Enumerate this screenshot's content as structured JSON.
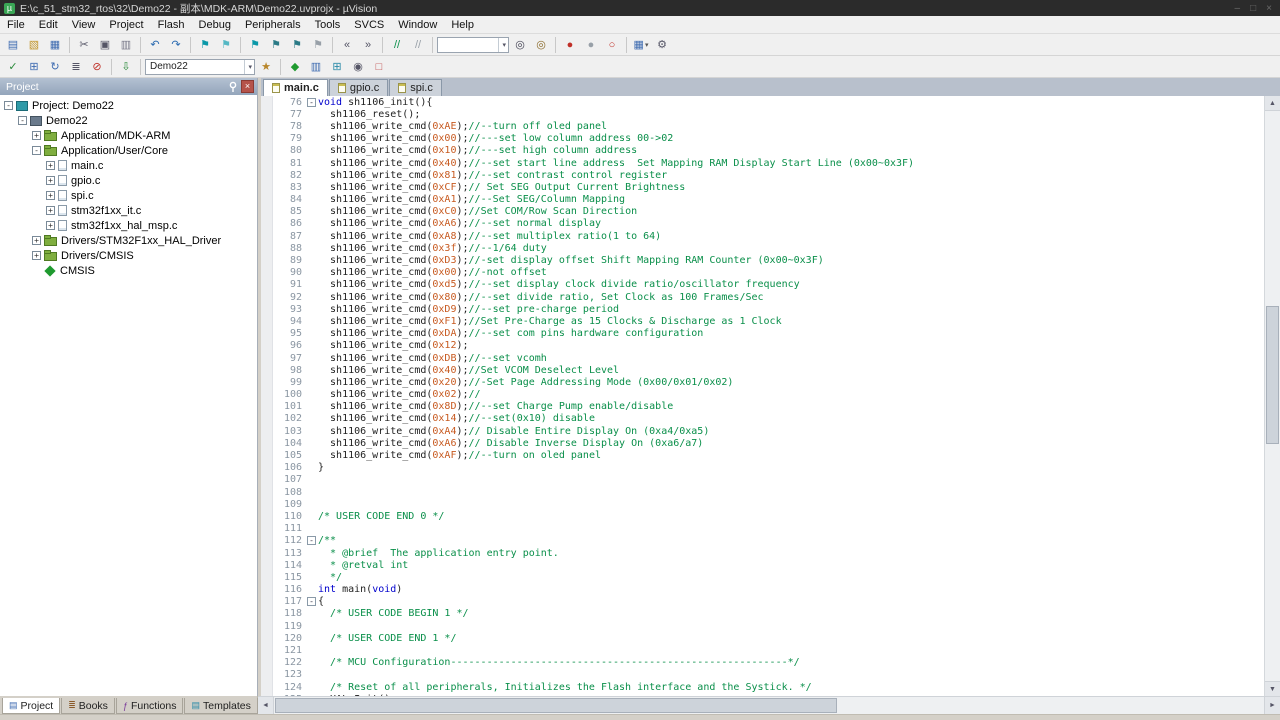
{
  "colors": {
    "keyword": "#0000cc",
    "comment": "#0a8f4a",
    "number": "#c75a20",
    "accent_green": "#3aa655"
  },
  "window": {
    "title": "E:\\c_51_stm32_rtos\\32\\Demo22 - 副本\\MDK-ARM\\Demo22.uvprojx - µVision",
    "controls": {
      "minimize": "–",
      "maximize": "□",
      "close": "×"
    }
  },
  "menubar": {
    "items": [
      "File",
      "Edit",
      "View",
      "Project",
      "Flash",
      "Debug",
      "Peripherals",
      "Tools",
      "SVCS",
      "Window",
      "Help"
    ]
  },
  "toolbars": {
    "main": [
      {
        "icon": "new-file-icon"
      },
      {
        "icon": "open-file-icon"
      },
      {
        "icon": "save-file-icon"
      },
      {
        "sep": true
      },
      {
        "icon": "cut-icon"
      },
      {
        "icon": "copy-icon"
      },
      {
        "icon": "paste-icon"
      },
      {
        "sep": true
      },
      {
        "icon": "undo-icon"
      },
      {
        "icon": "redo-icon"
      },
      {
        "sep": true
      },
      {
        "icon": "navigate-back-icon"
      },
      {
        "icon": "navigate-forward-icon"
      },
      {
        "sep": true
      },
      {
        "icon": "toggle-bookmark-icon"
      },
      {
        "icon": "prev-bookmark-icon"
      },
      {
        "icon": "next-bookmark-icon"
      },
      {
        "icon": "clear-bookmarks-icon"
      },
      {
        "sep": true
      },
      {
        "icon": "indent-left-icon"
      },
      {
        "icon": "indent-right-icon"
      },
      {
        "sep": true
      },
      {
        "icon": "comment-icon"
      },
      {
        "icon": "uncomment-icon"
      },
      {
        "sep": true
      },
      {
        "combo": "find-combo",
        "value": "",
        "width": 72
      },
      {
        "icon": "find-icon"
      },
      {
        "icon": "find-in-files-icon"
      },
      {
        "sep": true
      },
      {
        "icon": "toggle-breakpoint-icon"
      },
      {
        "icon": "disable-breakpoints-icon"
      },
      {
        "icon": "kill-breakpoints-icon"
      },
      {
        "sep": true
      },
      {
        "icon": "window-layout-icon",
        "dropdown": true
      },
      {
        "icon": "configure-icon"
      }
    ],
    "build": [
      {
        "icon": "translate-icon"
      },
      {
        "icon": "build-icon"
      },
      {
        "icon": "rebuild-icon"
      },
      {
        "icon": "batch-build-icon"
      },
      {
        "icon": "stop-build-icon"
      },
      {
        "sep": true
      },
      {
        "icon": "download-icon"
      },
      {
        "sep": true
      },
      {
        "combo": "target-select",
        "value": "Demo22",
        "width": 110
      },
      {
        "icon": "target-options-icon"
      },
      {
        "sep": true
      },
      {
        "icon": "manage-rte-icon"
      },
      {
        "icon": "file-extensions-icon"
      },
      {
        "icon": "pack-installer-icon"
      },
      {
        "icon": "debug-session-icon"
      },
      {
        "icon": "flash-erase-icon"
      }
    ]
  },
  "project_panel": {
    "title": "Project",
    "tree": [
      {
        "label": "Project: Demo22",
        "level": 0,
        "icon": "workspace",
        "exp": "minus"
      },
      {
        "label": "Demo22",
        "level": 1,
        "icon": "target",
        "exp": "minus"
      },
      {
        "label": "Application/MDK-ARM",
        "level": 2,
        "icon": "folder",
        "exp": "plus"
      },
      {
        "label": "Application/User/Core",
        "level": 2,
        "icon": "folder",
        "exp": "minus"
      },
      {
        "label": "main.c",
        "level": 3,
        "icon": "file",
        "exp": "plus"
      },
      {
        "label": "gpio.c",
        "level": 3,
        "icon": "file",
        "exp": "plus"
      },
      {
        "label": "spi.c",
        "level": 3,
        "icon": "file",
        "exp": "plus"
      },
      {
        "label": "stm32f1xx_it.c",
        "level": 3,
        "icon": "file",
        "exp": "plus"
      },
      {
        "label": "stm32f1xx_hal_msp.c",
        "level": 3,
        "icon": "file",
        "exp": "plus"
      },
      {
        "label": "Drivers/STM32F1xx_HAL_Driver",
        "level": 2,
        "icon": "folder",
        "exp": "plus"
      },
      {
        "label": "Drivers/CMSIS",
        "level": 2,
        "icon": "folder",
        "exp": "plus"
      },
      {
        "label": "CMSIS",
        "level": 2,
        "icon": "cmsis",
        "exp": "none"
      }
    ]
  },
  "editor": {
    "tabs": [
      {
        "label": "main.c",
        "active": true
      },
      {
        "label": "gpio.c",
        "active": false
      },
      {
        "label": "spi.c",
        "active": false
      }
    ],
    "lines": [
      {
        "n": 76,
        "f": 1,
        "s": [
          [
            "k",
            "void"
          ],
          [
            "p",
            " sh1106_init(){"
          ]
        ]
      },
      {
        "n": 77,
        "s": [
          [
            "p",
            "  sh1106_reset();"
          ]
        ]
      },
      {
        "n": 78,
        "s": [
          [
            "p",
            "  sh1106_write_cmd("
          ],
          [
            "n",
            "0xAE"
          ],
          [
            "p",
            ");"
          ],
          [
            "c",
            "//--turn off oled panel"
          ]
        ]
      },
      {
        "n": 79,
        "s": [
          [
            "p",
            "  sh1106_write_cmd("
          ],
          [
            "n",
            "0x00"
          ],
          [
            "p",
            ");"
          ],
          [
            "c",
            "//---set low column address 00->02"
          ]
        ]
      },
      {
        "n": 80,
        "s": [
          [
            "p",
            "  sh1106_write_cmd("
          ],
          [
            "n",
            "0x10"
          ],
          [
            "p",
            ");"
          ],
          [
            "c",
            "//---set high column address"
          ]
        ]
      },
      {
        "n": 81,
        "s": [
          [
            "p",
            "  sh1106_write_cmd("
          ],
          [
            "n",
            "0x40"
          ],
          [
            "p",
            ");"
          ],
          [
            "c",
            "//--set start line address  Set Mapping RAM Display Start Line (0x00~0x3F)"
          ]
        ]
      },
      {
        "n": 82,
        "s": [
          [
            "p",
            "  sh1106_write_cmd("
          ],
          [
            "n",
            "0x81"
          ],
          [
            "p",
            ");"
          ],
          [
            "c",
            "//--set contrast control register"
          ]
        ]
      },
      {
        "n": 83,
        "s": [
          [
            "p",
            "  sh1106_write_cmd("
          ],
          [
            "n",
            "0xCF"
          ],
          [
            "p",
            ");"
          ],
          [
            "c",
            "// Set SEG Output Current Brightness"
          ]
        ]
      },
      {
        "n": 84,
        "s": [
          [
            "p",
            "  sh1106_write_cmd("
          ],
          [
            "n",
            "0xA1"
          ],
          [
            "p",
            ");"
          ],
          [
            "c",
            "//--Set SEG/Column Mapping"
          ]
        ]
      },
      {
        "n": 85,
        "s": [
          [
            "p",
            "  sh1106_write_cmd("
          ],
          [
            "n",
            "0xC0"
          ],
          [
            "p",
            ");"
          ],
          [
            "c",
            "//Set COM/Row Scan Direction"
          ]
        ]
      },
      {
        "n": 86,
        "s": [
          [
            "p",
            "  sh1106_write_cmd("
          ],
          [
            "n",
            "0xA6"
          ],
          [
            "p",
            ");"
          ],
          [
            "c",
            "//--set normal display"
          ]
        ]
      },
      {
        "n": 87,
        "s": [
          [
            "p",
            "  sh1106_write_cmd("
          ],
          [
            "n",
            "0xA8"
          ],
          [
            "p",
            ");"
          ],
          [
            "c",
            "//--set multiplex ratio(1 to 64)"
          ]
        ]
      },
      {
        "n": 88,
        "s": [
          [
            "p",
            "  sh1106_write_cmd("
          ],
          [
            "n",
            "0x3f"
          ],
          [
            "p",
            ");"
          ],
          [
            "c",
            "//--1/64 duty"
          ]
        ]
      },
      {
        "n": 89,
        "s": [
          [
            "p",
            "  sh1106_write_cmd("
          ],
          [
            "n",
            "0xD3"
          ],
          [
            "p",
            ");"
          ],
          [
            "c",
            "//-set display offset Shift Mapping RAM Counter (0x00~0x3F)"
          ]
        ]
      },
      {
        "n": 90,
        "s": [
          [
            "p",
            "  sh1106_write_cmd("
          ],
          [
            "n",
            "0x00"
          ],
          [
            "p",
            ");"
          ],
          [
            "c",
            "//-not offset"
          ]
        ]
      },
      {
        "n": 91,
        "s": [
          [
            "p",
            "  sh1106_write_cmd("
          ],
          [
            "n",
            "0xd5"
          ],
          [
            "p",
            ");"
          ],
          [
            "c",
            "//--set display clock divide ratio/oscillator frequency"
          ]
        ]
      },
      {
        "n": 92,
        "s": [
          [
            "p",
            "  sh1106_write_cmd("
          ],
          [
            "n",
            "0x80"
          ],
          [
            "p",
            ");"
          ],
          [
            "c",
            "//--set divide ratio, Set Clock as 100 Frames/Sec"
          ]
        ]
      },
      {
        "n": 93,
        "s": [
          [
            "p",
            "  sh1106_write_cmd("
          ],
          [
            "n",
            "0xD9"
          ],
          [
            "p",
            ");"
          ],
          [
            "c",
            "//--set pre-charge period"
          ]
        ]
      },
      {
        "n": 94,
        "s": [
          [
            "p",
            "  sh1106_write_cmd("
          ],
          [
            "n",
            "0xF1"
          ],
          [
            "p",
            ");"
          ],
          [
            "c",
            "//Set Pre-Charge as 15 Clocks & Discharge as 1 Clock"
          ]
        ]
      },
      {
        "n": 95,
        "s": [
          [
            "p",
            "  sh1106_write_cmd("
          ],
          [
            "n",
            "0xDA"
          ],
          [
            "p",
            ");"
          ],
          [
            "c",
            "//--set com pins hardware configuration"
          ]
        ]
      },
      {
        "n": 96,
        "s": [
          [
            "p",
            "  sh1106_write_cmd("
          ],
          [
            "n",
            "0x12"
          ],
          [
            "p",
            ");"
          ]
        ]
      },
      {
        "n": 97,
        "s": [
          [
            "p",
            "  sh1106_write_cmd("
          ],
          [
            "n",
            "0xDB"
          ],
          [
            "p",
            ");"
          ],
          [
            "c",
            "//--set vcomh"
          ]
        ]
      },
      {
        "n": 98,
        "s": [
          [
            "p",
            "  sh1106_write_cmd("
          ],
          [
            "n",
            "0x40"
          ],
          [
            "p",
            ");"
          ],
          [
            "c",
            "//Set VCOM Deselect Level"
          ]
        ]
      },
      {
        "n": 99,
        "s": [
          [
            "p",
            "  sh1106_write_cmd("
          ],
          [
            "n",
            "0x20"
          ],
          [
            "p",
            ");"
          ],
          [
            "c",
            "//-Set Page Addressing Mode (0x00/0x01/0x02)"
          ]
        ]
      },
      {
        "n": 100,
        "s": [
          [
            "p",
            "  sh1106_write_cmd("
          ],
          [
            "n",
            "0x02"
          ],
          [
            "p",
            ");"
          ],
          [
            "c",
            "//"
          ]
        ]
      },
      {
        "n": 101,
        "s": [
          [
            "p",
            "  sh1106_write_cmd("
          ],
          [
            "n",
            "0x8D"
          ],
          [
            "p",
            ");"
          ],
          [
            "c",
            "//--set Charge Pump enable/disable"
          ]
        ]
      },
      {
        "n": 102,
        "s": [
          [
            "p",
            "  sh1106_write_cmd("
          ],
          [
            "n",
            "0x14"
          ],
          [
            "p",
            ");"
          ],
          [
            "c",
            "//--set(0x10) disable"
          ]
        ]
      },
      {
        "n": 103,
        "s": [
          [
            "p",
            "  sh1106_write_cmd("
          ],
          [
            "n",
            "0xA4"
          ],
          [
            "p",
            ");"
          ],
          [
            "c",
            "// Disable Entire Display On (0xa4/0xa5)"
          ]
        ]
      },
      {
        "n": 104,
        "s": [
          [
            "p",
            "  sh1106_write_cmd("
          ],
          [
            "n",
            "0xA6"
          ],
          [
            "p",
            ");"
          ],
          [
            "c",
            "// Disable Inverse Display On (0xa6/a7)"
          ]
        ]
      },
      {
        "n": 105,
        "s": [
          [
            "p",
            "  sh1106_write_cmd("
          ],
          [
            "n",
            "0xAF"
          ],
          [
            "p",
            ");"
          ],
          [
            "c",
            "//--turn on oled panel"
          ]
        ]
      },
      {
        "n": 106,
        "s": [
          [
            "p",
            "}"
          ]
        ]
      },
      {
        "n": 107,
        "s": []
      },
      {
        "n": 108,
        "s": []
      },
      {
        "n": 109,
        "s": []
      },
      {
        "n": 110,
        "s": [
          [
            "c",
            "/* USER CODE END 0 */"
          ]
        ]
      },
      {
        "n": 111,
        "s": []
      },
      {
        "n": 112,
        "f": 1,
        "s": [
          [
            "c",
            "/**"
          ]
        ]
      },
      {
        "n": 113,
        "s": [
          [
            "c",
            "  * @brief  The application entry point."
          ]
        ]
      },
      {
        "n": 114,
        "s": [
          [
            "c",
            "  * @retval int"
          ]
        ]
      },
      {
        "n": 115,
        "s": [
          [
            "c",
            "  */"
          ]
        ]
      },
      {
        "n": 116,
        "s": [
          [
            "k",
            "int"
          ],
          [
            "p",
            " main("
          ],
          [
            "k",
            "void"
          ],
          [
            "p",
            ")"
          ]
        ]
      },
      {
        "n": 117,
        "f": 1,
        "s": [
          [
            "p",
            "{"
          ]
        ]
      },
      {
        "n": 118,
        "s": [
          [
            "p",
            "  "
          ],
          [
            "c",
            "/* USER CODE BEGIN 1 */"
          ]
        ]
      },
      {
        "n": 119,
        "s": []
      },
      {
        "n": 120,
        "s": [
          [
            "p",
            "  "
          ],
          [
            "c",
            "/* USER CODE END 1 */"
          ]
        ]
      },
      {
        "n": 121,
        "s": []
      },
      {
        "n": 122,
        "s": [
          [
            "p",
            "  "
          ],
          [
            "c",
            "/* MCU Configuration--------------------------------------------------------*/"
          ]
        ]
      },
      {
        "n": 123,
        "s": []
      },
      {
        "n": 124,
        "s": [
          [
            "p",
            "  "
          ],
          [
            "c",
            "/* Reset of all peripherals, Initializes the Flash interface and the Systick. */"
          ]
        ]
      },
      {
        "n": 125,
        "s": [
          [
            "p",
            "  HAL_Init();"
          ]
        ]
      }
    ]
  },
  "bottom": {
    "tabs": [
      {
        "label": "Project",
        "icon": "project-tab-icon",
        "active": true
      },
      {
        "label": "Books",
        "icon": "books-icon",
        "active": false
      },
      {
        "label": "Functions",
        "icon": "functions-icon",
        "active": false
      },
      {
        "label": "Templates",
        "icon": "templates-icon",
        "active": false
      }
    ]
  }
}
